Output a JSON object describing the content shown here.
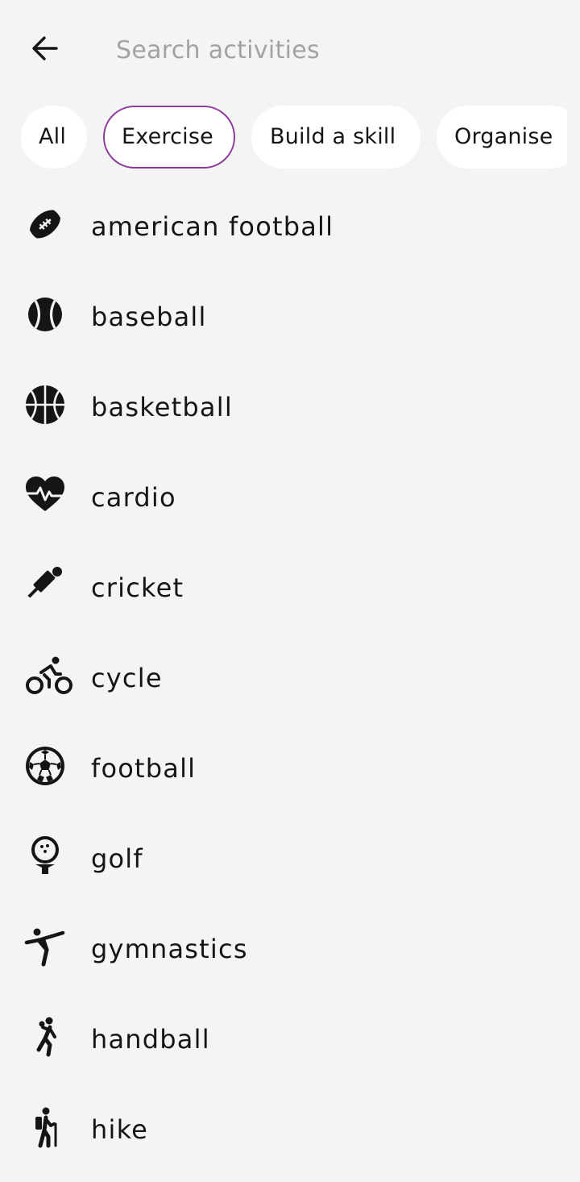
{
  "search": {
    "placeholder": "Search activities",
    "value": ""
  },
  "filters": [
    {
      "label": "All",
      "selected": false
    },
    {
      "label": "Exercise",
      "selected": true
    },
    {
      "label": "Build a skill",
      "selected": false
    },
    {
      "label": "Organise",
      "selected": false
    }
  ],
  "colors": {
    "accent": "#8e3a9c",
    "background": "#f4f4f4",
    "chip_background": "#ffffff",
    "placeholder": "#a3a3a3",
    "text": "#151515"
  },
  "activities": [
    {
      "label": "american football",
      "icon": "american-football-icon"
    },
    {
      "label": "baseball",
      "icon": "baseball-icon"
    },
    {
      "label": "basketball",
      "icon": "basketball-icon"
    },
    {
      "label": "cardio",
      "icon": "heart-pulse-icon"
    },
    {
      "label": "cricket",
      "icon": "cricket-icon"
    },
    {
      "label": "cycle",
      "icon": "cyclist-icon"
    },
    {
      "label": "football",
      "icon": "soccer-ball-icon"
    },
    {
      "label": "golf",
      "icon": "golf-ball-tee-icon"
    },
    {
      "label": "gymnastics",
      "icon": "gymnast-icon"
    },
    {
      "label": "handball",
      "icon": "handball-player-icon"
    },
    {
      "label": "hike",
      "icon": "hiker-icon"
    }
  ]
}
